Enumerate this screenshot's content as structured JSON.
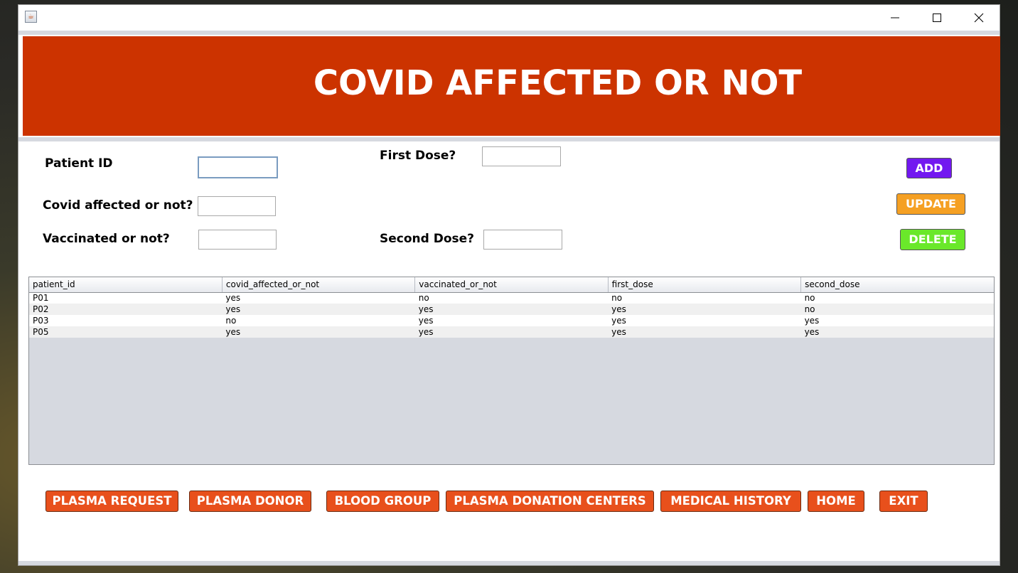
{
  "window": {
    "title": ""
  },
  "banner": {
    "title": "COVID AFFECTED OR NOT"
  },
  "form": {
    "patient_id_label": "Patient ID",
    "patient_id_value": "",
    "covid_label": "Covid affected or not?",
    "covid_value": "",
    "vaccinated_label": "Vaccinated or not?",
    "vaccinated_value": "",
    "first_dose_label": "First Dose?",
    "first_dose_value": "",
    "second_dose_label": "Second Dose?",
    "second_dose_value": ""
  },
  "actions": {
    "add": "ADD",
    "update": "UPDATE",
    "delete": "DELETE"
  },
  "table": {
    "columns": [
      "patient_id",
      "covid_affected_or_not",
      "vaccinated_or_not",
      "first_dose",
      "second_dose"
    ],
    "rows": [
      [
        "P01",
        "yes",
        "no",
        "no",
        "no"
      ],
      [
        "P02",
        "yes",
        "yes",
        "yes",
        "no"
      ],
      [
        "P03",
        "no",
        "yes",
        "yes",
        "yes"
      ],
      [
        "P05",
        "yes",
        "yes",
        "yes",
        "yes"
      ]
    ]
  },
  "nav": {
    "plasma_request": "PLASMA REQUEST",
    "plasma_donor": "PLASMA DONOR",
    "blood_group": "BLOOD GROUP",
    "donation_centers": "PLASMA DONATION CENTERS",
    "medical_history": "MEDICAL HISTORY",
    "home": "HOME",
    "exit": "EXIT"
  },
  "colors": {
    "banner": "#cc3300",
    "add": "#7218f0",
    "update": "#f5a023",
    "delete": "#6ae82a",
    "nav": "#e8501c"
  }
}
